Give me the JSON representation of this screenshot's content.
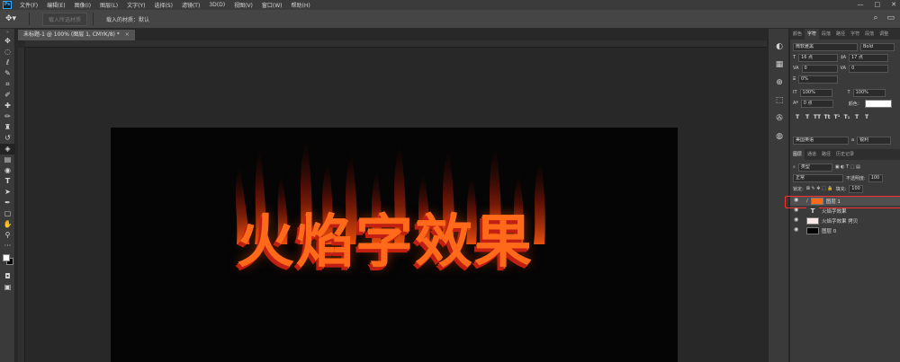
{
  "menubar": {
    "logo": "Ps",
    "items": [
      "文件(F)",
      "编辑(E)",
      "图像(I)",
      "图层(L)",
      "文字(Y)",
      "选择(S)",
      "滤镜(T)",
      "3D(D)",
      "视图(V)",
      "窗口(W)",
      "帮助(H)"
    ],
    "controls": [
      "—",
      "□",
      "✕"
    ]
  },
  "options": {
    "tool_icon": "move-tool-icon",
    "disabled_button": "载入所选材质",
    "loaded_material_label": "载入的材质：默认"
  },
  "toolbar": {
    "tools": [
      "move-icon",
      "marquee-icon",
      "lasso-icon",
      "quick-select-icon",
      "crop-icon",
      "eyedropper-icon",
      "healing-brush-icon",
      "brush-icon",
      "clone-stamp-icon",
      "history-brush-icon",
      "eraser-icon",
      "gradient-icon",
      "blur-icon",
      "dodge-icon",
      "pen-icon",
      "type-icon",
      "path-select-icon",
      "shape-icon",
      "hand-icon",
      "zoom-icon"
    ],
    "colors": {
      "foreground": "#ffffff",
      "background": "#000000"
    }
  },
  "document": {
    "tab_title": "未标题-1 @ 100% (图层 1, CMYK/8) *",
    "canvas_text": "火焰字效果",
    "canvas_text_color": "#ff6a1a",
    "canvas_bg": "#050505"
  },
  "character_panel": {
    "tabs": [
      "颜色",
      "字符",
      "段落",
      "路径",
      "字符",
      "段落",
      "调整"
    ],
    "active_tab": "字符",
    "font_family": "微软雅黑",
    "font_style": "Bold",
    "font_size": "16 点",
    "leading": "17 点",
    "kerning": "0",
    "tracking": "0",
    "tsume": "0%",
    "vertical_scale": "100%",
    "horizontal_scale": "100%",
    "baseline_shift": "0 点",
    "color_label": "颜色：",
    "format_buttons": [
      "T",
      "T",
      "TT",
      "Tt",
      "T¹",
      "T₁",
      "T",
      "T"
    ],
    "language": "美国英语",
    "antialias": "锐利",
    "aa_label": "a"
  },
  "layers_panel": {
    "tabs": [
      "图层",
      "通道",
      "路径",
      "历史记录"
    ],
    "active_tab": "图层",
    "filter_kind": "类型",
    "blend_mode": "正常",
    "opacity_label": "不透明度:",
    "opacity_value": "100",
    "lock_label": "锁定:",
    "fill_label": "填充:",
    "fill_value": "100",
    "layers": [
      {
        "name": "图层 1",
        "thumb": "#ff6a1a",
        "selected": true,
        "type": "raster"
      },
      {
        "name": "火焰字效果",
        "thumb": "",
        "selected": false,
        "type": "text"
      },
      {
        "name": "火焰字效果 拷贝",
        "thumb": "#fbe9e7",
        "selected": false,
        "type": "raster"
      },
      {
        "name": "图层 0",
        "thumb": "#000000",
        "selected": false,
        "type": "raster"
      }
    ]
  }
}
